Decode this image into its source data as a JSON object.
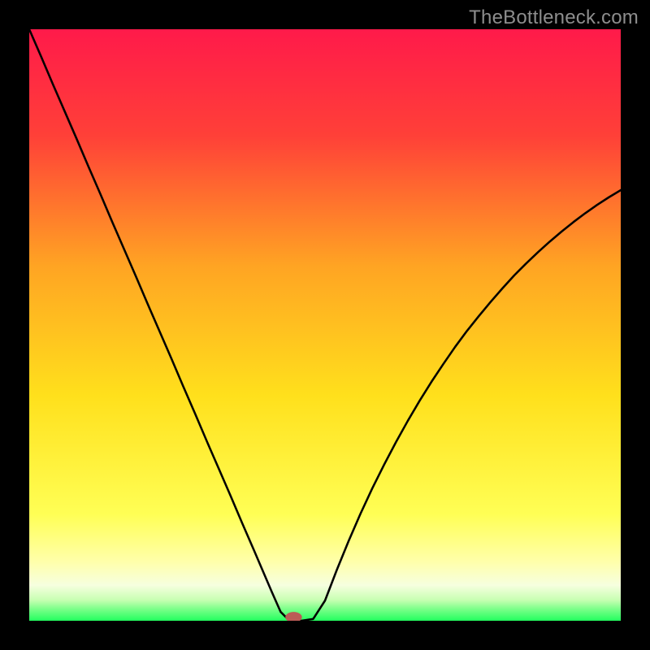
{
  "attribution": "TheBottleneck.com",
  "colors": {
    "frame": "#000000",
    "gradient_top": "#ff1a4a",
    "gradient_mid_upper": "#ff6a2f",
    "gradient_mid": "#ffd21f",
    "gradient_lower": "#ffff6a",
    "gradient_white": "#fbfff0",
    "gradient_bottom": "#2eff68",
    "curve": "#000000",
    "marker": "#bb5b56"
  },
  "chart_data": {
    "type": "line",
    "title": "",
    "xlabel": "",
    "ylabel": "",
    "xlim": [
      0,
      100
    ],
    "ylim": [
      0,
      100
    ],
    "x": [
      0,
      2,
      4,
      6,
      8,
      10,
      12,
      14,
      16,
      18,
      20,
      22,
      24,
      26,
      28,
      30,
      32,
      34,
      36,
      38,
      39.5,
      41,
      42.5,
      44,
      46,
      48,
      50,
      52,
      54,
      56,
      58,
      60,
      62,
      64,
      66,
      68,
      70,
      72,
      74,
      76,
      78,
      80,
      82,
      84,
      86,
      88,
      90,
      92,
      94,
      96,
      98,
      100
    ],
    "values": [
      100,
      95.4,
      90.7,
      86.1,
      81.5,
      76.8,
      72.2,
      67.5,
      62.9,
      58.3,
      53.6,
      49.0,
      44.4,
      39.7,
      35.1,
      30.4,
      25.8,
      21.2,
      16.5,
      11.9,
      8.4,
      4.9,
      1.5,
      0.0,
      0.0,
      0.3,
      3.4,
      8.6,
      13.5,
      18.1,
      22.4,
      26.4,
      30.2,
      33.8,
      37.2,
      40.4,
      43.4,
      46.3,
      49.0,
      51.5,
      53.9,
      56.2,
      58.4,
      60.4,
      62.3,
      64.1,
      65.8,
      67.4,
      68.9,
      70.3,
      71.6,
      72.8
    ],
    "marker": {
      "x": 44.7,
      "y": 0.6
    },
    "annotations": []
  }
}
